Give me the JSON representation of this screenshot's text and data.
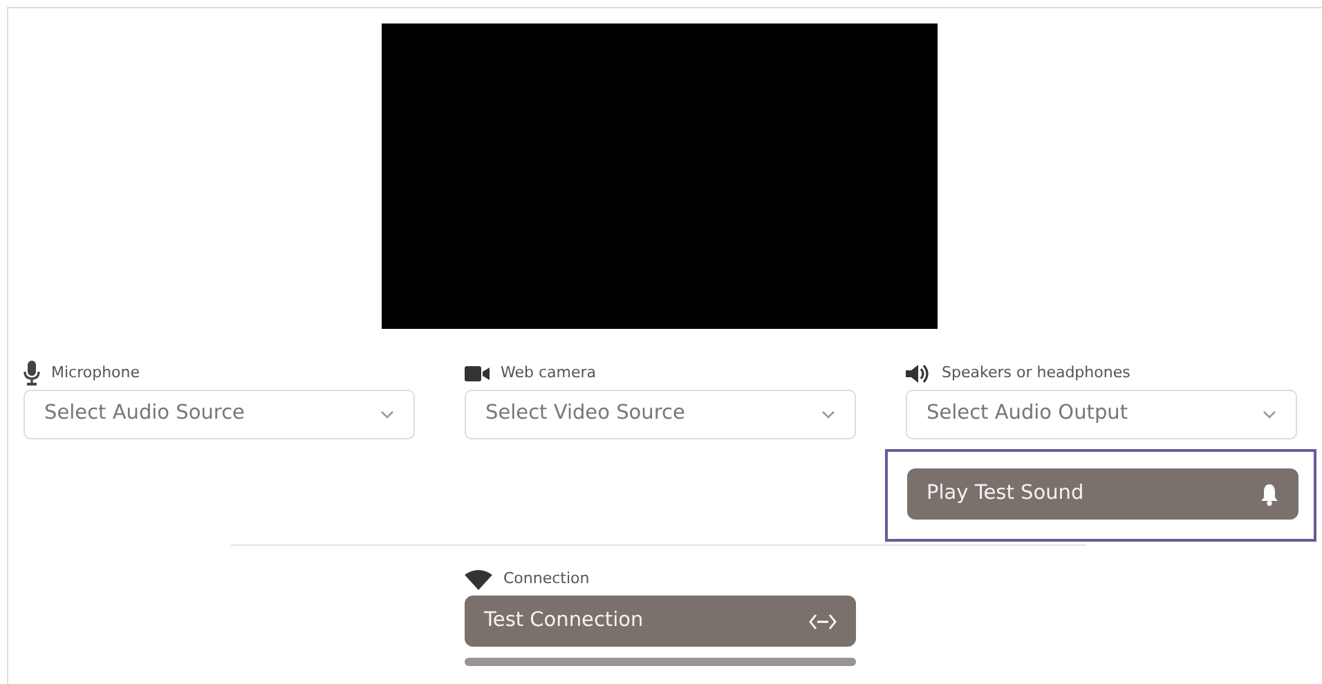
{
  "video": {
    "kind": "preview"
  },
  "devices": [
    {
      "kind": "microphone",
      "label": "Microphone",
      "placeholder": "Select Audio Source"
    },
    {
      "kind": "camera",
      "label": "Web camera",
      "placeholder": "Select Video Source"
    },
    {
      "kind": "speaker",
      "label": "Speakers or headphones",
      "placeholder": "Select Audio Output"
    }
  ],
  "test_sound": {
    "label": "Play Test Sound",
    "focused": true
  },
  "connection": {
    "label": "Connection",
    "button": "Test Connection",
    "progress": {
      "level": 1
    }
  }
}
